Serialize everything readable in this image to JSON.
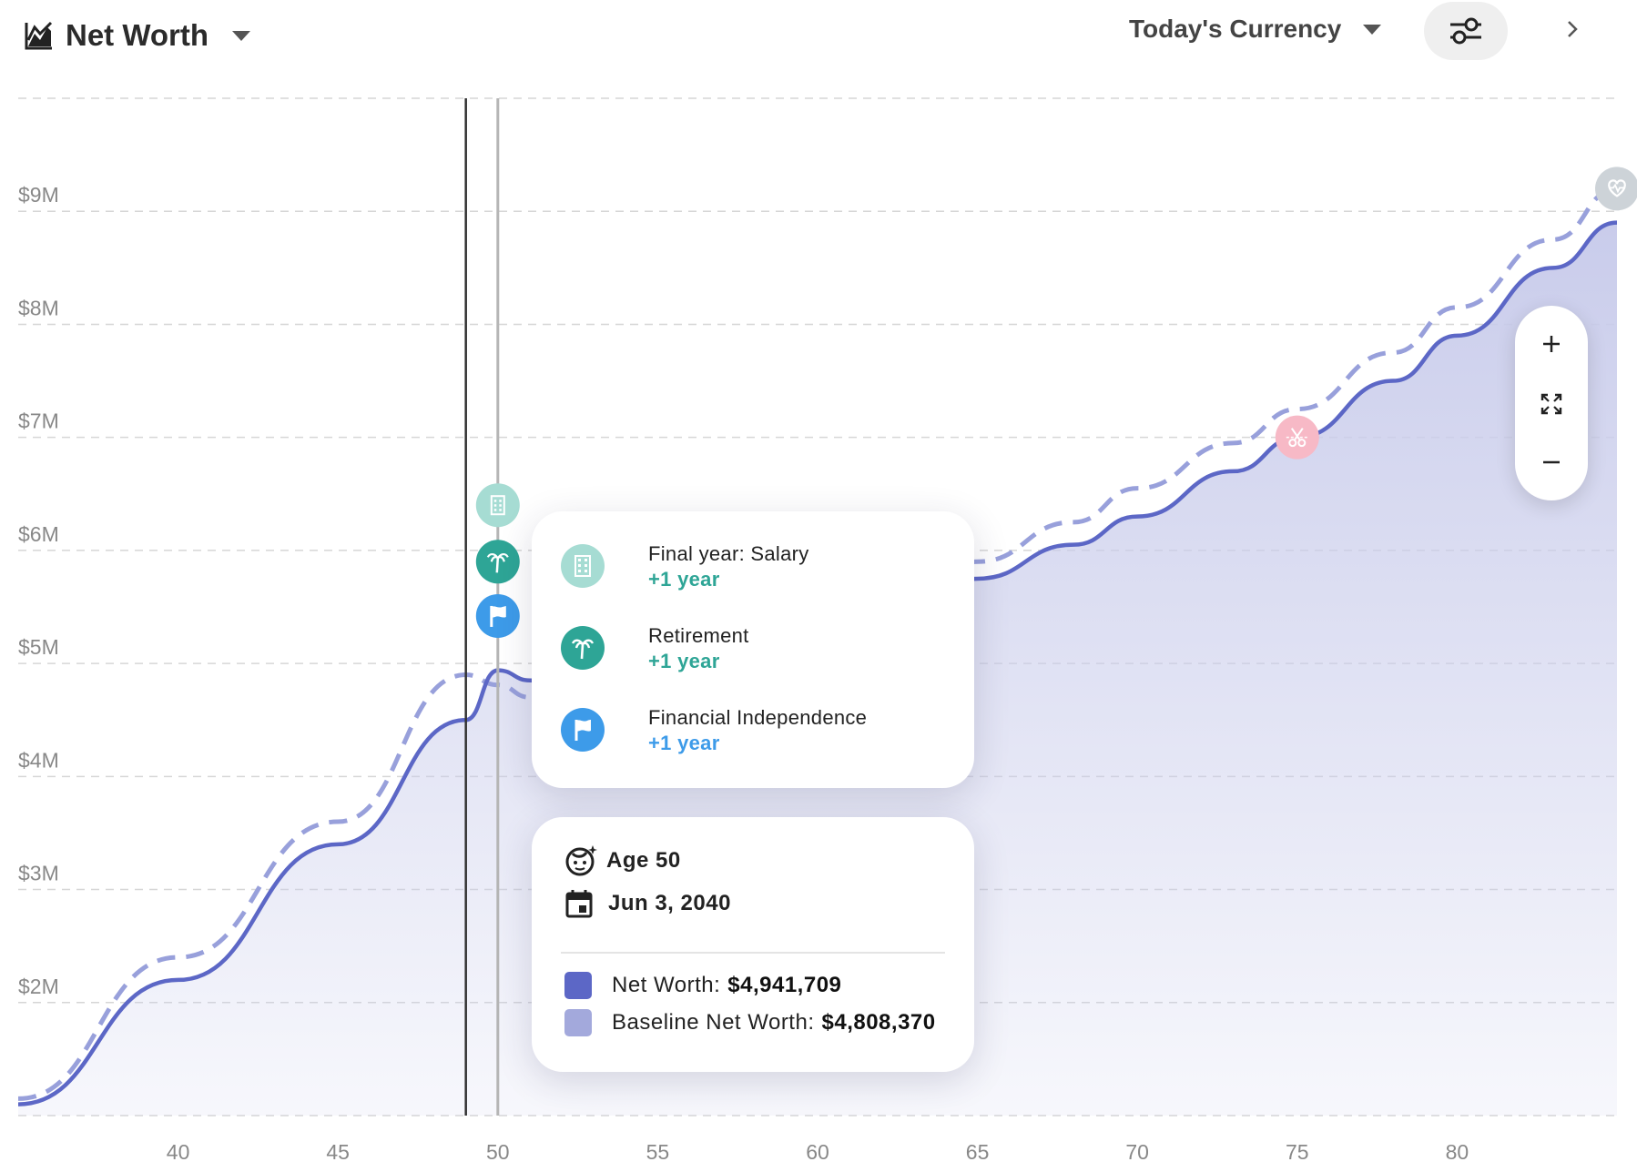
{
  "header": {
    "title": "Net Worth",
    "currency": "Today's Currency"
  },
  "icons": {
    "title": "area-chart-icon",
    "settings": "sliders-icon",
    "next": "chevron-right-icon",
    "zoom_in": "plus-icon",
    "fit": "expand-icon",
    "zoom_out": "minus-icon",
    "salary": "building-icon",
    "retirement": "palm-tree-icon",
    "fi": "flag-icon",
    "child": "baby-face-icon",
    "date": "calendar-icon",
    "late_event": "scissors-icon",
    "end_event": "heart-icon"
  },
  "colors": {
    "net_worth": "#5c67c6",
    "baseline": "#98a0db",
    "fill_top": "#c9cceb",
    "salary_icon": "#a6dcd3",
    "retirement_icon": "#2ea596",
    "fi_icon": "#3d9be9",
    "late_event": "#f7b9c6",
    "cursor": "#333333"
  },
  "chart_data": {
    "type": "line",
    "x_ticks": [
      40,
      45,
      50,
      55,
      60,
      65,
      70,
      75,
      80
    ],
    "y_ticks": [
      "$2M",
      "$3M",
      "$4M",
      "$5M",
      "$6M",
      "$7M",
      "$8M",
      "$9M"
    ],
    "y_tick_values": [
      2,
      3,
      4,
      5,
      6,
      7,
      8,
      9
    ],
    "xlim": [
      35,
      85
    ],
    "ylim": [
      1,
      10
    ],
    "y_unit": "millions USD",
    "grid": true,
    "area_fill": true,
    "series": [
      {
        "name": "Net Worth",
        "style": "solid",
        "x": [
          35,
          40,
          45,
          49,
          50,
          51,
          53,
          55,
          57,
          60,
          63,
          65,
          68,
          70,
          73,
          75,
          78,
          80,
          83,
          85
        ],
        "y": [
          1.1,
          2.2,
          3.4,
          4.5,
          4.94,
          4.85,
          4.8,
          4.85,
          4.95,
          5.2,
          5.55,
          5.75,
          6.05,
          6.3,
          6.7,
          7.0,
          7.5,
          7.9,
          8.5,
          8.9
        ]
      },
      {
        "name": "Baseline Net Worth",
        "style": "dashed",
        "x": [
          35,
          40,
          45,
          49,
          50,
          51,
          53,
          55,
          57,
          60,
          63,
          65,
          68,
          70,
          73,
          75,
          78,
          80,
          83,
          85
        ],
        "y": [
          1.15,
          2.4,
          3.6,
          4.9,
          4.81,
          4.7,
          4.68,
          4.75,
          4.9,
          5.2,
          5.6,
          5.9,
          6.25,
          6.55,
          6.95,
          7.25,
          7.75,
          8.15,
          8.75,
          9.2
        ]
      }
    ],
    "cursor_age": 49,
    "hover_age": 50,
    "markers": [
      {
        "age": 50,
        "y": 6.4,
        "icon": "building-icon",
        "color": "#a6dcd3"
      },
      {
        "age": 50,
        "y": 5.9,
        "icon": "palm-tree-icon",
        "color": "#2ea596"
      },
      {
        "age": 50,
        "y": 5.42,
        "icon": "flag-icon",
        "color": "#3d9be9"
      },
      {
        "age": 75,
        "y": 7.0,
        "icon": "scissors-icon",
        "color": "#f7b9c6"
      },
      {
        "age": 85,
        "y": 9.2,
        "icon": "heart-icon",
        "color": "#cdd3d8"
      }
    ]
  },
  "tooltip_events": [
    {
      "label": "Final year: Salary",
      "delta": "+1 year",
      "icon": "building-icon",
      "icon_color": "#a6dcd3",
      "delta_color": "#2ea596"
    },
    {
      "label": "Retirement",
      "delta": "+1 year",
      "icon": "palm-tree-icon",
      "icon_color": "#2ea596",
      "delta_color": "#2ea596"
    },
    {
      "label": "Financial Independence",
      "delta": "+1 year",
      "icon": "flag-icon",
      "icon_color": "#3d9be9",
      "delta_color": "#3d9be9"
    }
  ],
  "tooltip_info": {
    "age": "Age 50",
    "date": "Jun 3, 2040",
    "net_worth_label": "Net Worth:",
    "net_worth_value": "$4,941,709",
    "baseline_label": "Baseline Net Worth:",
    "baseline_value": "$4,808,370"
  }
}
